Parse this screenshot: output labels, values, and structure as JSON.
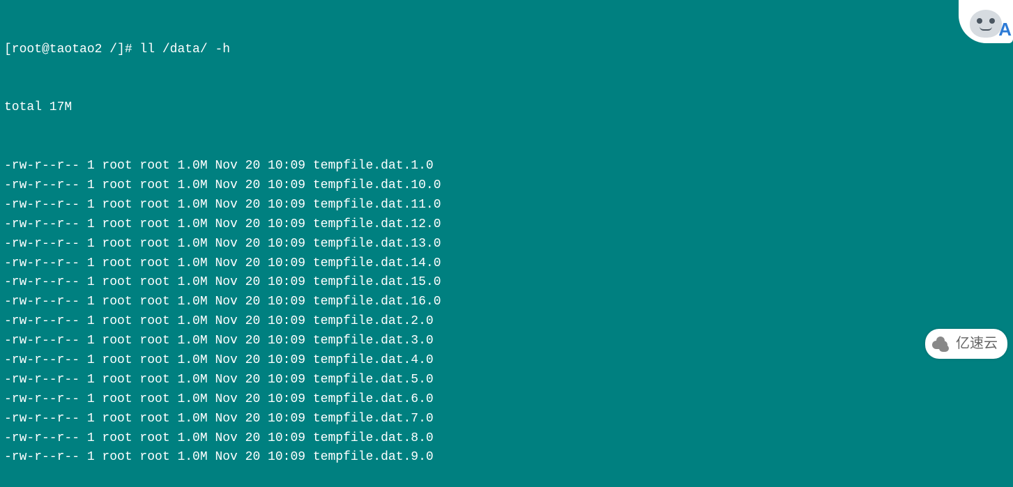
{
  "prompt": "[root@taotao2 /]# ll /data/ -h",
  "total_line": "total 17M",
  "columns": [
    "perms",
    "links",
    "owner",
    "group",
    "size",
    "month",
    "day",
    "time",
    "name"
  ],
  "files": [
    {
      "perms": "-rw-r--r--",
      "links": "1",
      "owner": "root",
      "group": "root",
      "size": "1.0M",
      "month": "Nov",
      "day": "20",
      "time": "10:09",
      "name": "tempfile.dat.1.0"
    },
    {
      "perms": "-rw-r--r--",
      "links": "1",
      "owner": "root",
      "group": "root",
      "size": "1.0M",
      "month": "Nov",
      "day": "20",
      "time": "10:09",
      "name": "tempfile.dat.10.0"
    },
    {
      "perms": "-rw-r--r--",
      "links": "1",
      "owner": "root",
      "group": "root",
      "size": "1.0M",
      "month": "Nov",
      "day": "20",
      "time": "10:09",
      "name": "tempfile.dat.11.0"
    },
    {
      "perms": "-rw-r--r--",
      "links": "1",
      "owner": "root",
      "group": "root",
      "size": "1.0M",
      "month": "Nov",
      "day": "20",
      "time": "10:09",
      "name": "tempfile.dat.12.0"
    },
    {
      "perms": "-rw-r--r--",
      "links": "1",
      "owner": "root",
      "group": "root",
      "size": "1.0M",
      "month": "Nov",
      "day": "20",
      "time": "10:09",
      "name": "tempfile.dat.13.0"
    },
    {
      "perms": "-rw-r--r--",
      "links": "1",
      "owner": "root",
      "group": "root",
      "size": "1.0M",
      "month": "Nov",
      "day": "20",
      "time": "10:09",
      "name": "tempfile.dat.14.0"
    },
    {
      "perms": "-rw-r--r--",
      "links": "1",
      "owner": "root",
      "group": "root",
      "size": "1.0M",
      "month": "Nov",
      "day": "20",
      "time": "10:09",
      "name": "tempfile.dat.15.0"
    },
    {
      "perms": "-rw-r--r--",
      "links": "1",
      "owner": "root",
      "group": "root",
      "size": "1.0M",
      "month": "Nov",
      "day": "20",
      "time": "10:09",
      "name": "tempfile.dat.16.0"
    },
    {
      "perms": "-rw-r--r--",
      "links": "1",
      "owner": "root",
      "group": "root",
      "size": "1.0M",
      "month": "Nov",
      "day": "20",
      "time": "10:09",
      "name": "tempfile.dat.2.0"
    },
    {
      "perms": "-rw-r--r--",
      "links": "1",
      "owner": "root",
      "group": "root",
      "size": "1.0M",
      "month": "Nov",
      "day": "20",
      "time": "10:09",
      "name": "tempfile.dat.3.0"
    },
    {
      "perms": "-rw-r--r--",
      "links": "1",
      "owner": "root",
      "group": "root",
      "size": "1.0M",
      "month": "Nov",
      "day": "20",
      "time": "10:09",
      "name": "tempfile.dat.4.0"
    },
    {
      "perms": "-rw-r--r--",
      "links": "1",
      "owner": "root",
      "group": "root",
      "size": "1.0M",
      "month": "Nov",
      "day": "20",
      "time": "10:09",
      "name": "tempfile.dat.5.0"
    },
    {
      "perms": "-rw-r--r--",
      "links": "1",
      "owner": "root",
      "group": "root",
      "size": "1.0M",
      "month": "Nov",
      "day": "20",
      "time": "10:09",
      "name": "tempfile.dat.6.0"
    },
    {
      "perms": "-rw-r--r--",
      "links": "1",
      "owner": "root",
      "group": "root",
      "size": "1.0M",
      "month": "Nov",
      "day": "20",
      "time": "10:09",
      "name": "tempfile.dat.7.0"
    },
    {
      "perms": "-rw-r--r--",
      "links": "1",
      "owner": "root",
      "group": "root",
      "size": "1.0M",
      "month": "Nov",
      "day": "20",
      "time": "10:09",
      "name": "tempfile.dat.8.0"
    },
    {
      "perms": "-rw-r--r--",
      "links": "1",
      "owner": "root",
      "group": "root",
      "size": "1.0M",
      "month": "Nov",
      "day": "20",
      "time": "10:09",
      "name": "tempfile.dat.9.0"
    }
  ],
  "mascot": {
    "letter": "A"
  },
  "watermark": {
    "text": "亿速云"
  }
}
